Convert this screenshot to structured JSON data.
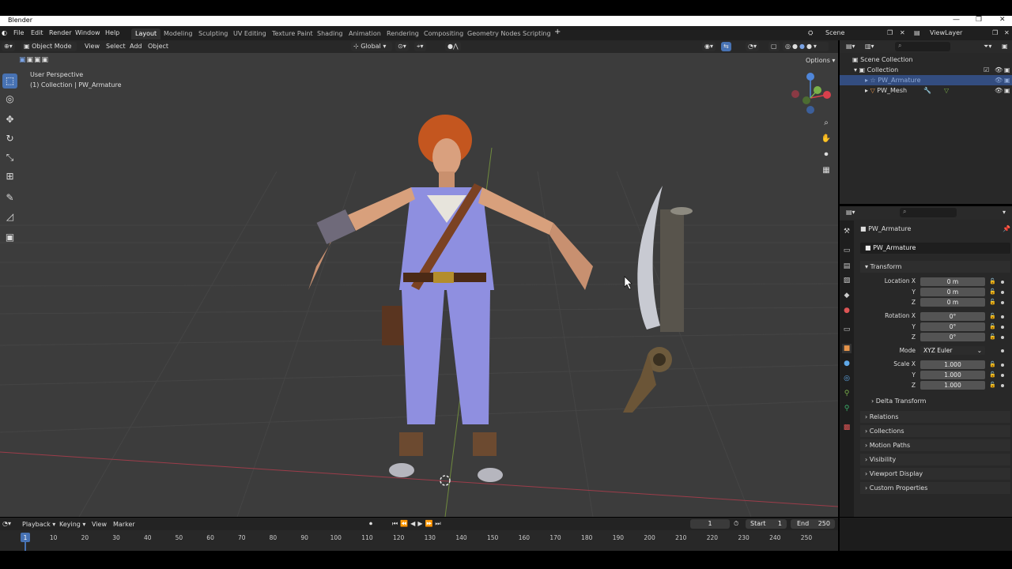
{
  "app": {
    "title": "Blender"
  },
  "menus": [
    "File",
    "Edit",
    "Render",
    "Window",
    "Help"
  ],
  "workspaces": [
    "Layout",
    "Modeling",
    "Sculpting",
    "UV Editing",
    "Texture Paint",
    "Shading",
    "Animation",
    "Rendering",
    "Compositing",
    "Geometry Nodes",
    "Scripting"
  ],
  "active_workspace": "Layout",
  "scene": {
    "name": "Scene",
    "view_layer": "ViewLayer"
  },
  "viewport_header": {
    "mode": "Object Mode",
    "menus": [
      "View",
      "Select",
      "Add",
      "Object"
    ],
    "orientation": "Global",
    "options_label": "Options"
  },
  "viewport": {
    "perspective_label": "User Perspective",
    "collection_label": "(1) Collection | PW_Armature"
  },
  "outliner": {
    "root": "Scene Collection",
    "collection": "Collection",
    "items": [
      "PW_Armature",
      "PW_Mesh"
    ]
  },
  "properties": {
    "object_name": "PW_Armature",
    "data_name": "PW_Armature",
    "transform_label": "Transform",
    "location_label": "Location X",
    "rotation_label": "Rotation X",
    "scale_label": "Scale X",
    "axis_y": "Y",
    "axis_z": "Z",
    "location": [
      "0 m",
      "0 m",
      "0 m"
    ],
    "rotation": [
      "0°",
      "0°",
      "0°"
    ],
    "mode_label": "Mode",
    "mode_value": "XYZ Euler",
    "scale": [
      "1.000",
      "1.000",
      "1.000"
    ],
    "delta_transform": "Delta Transform",
    "panels": [
      "Relations",
      "Collections",
      "Motion Paths",
      "Visibility",
      "Viewport Display",
      "Custom Properties"
    ]
  },
  "timeline": {
    "menus": [
      "Playback",
      "Keying",
      "View",
      "Marker"
    ],
    "current_frame": "1",
    "start_label": "Start",
    "start": "1",
    "end_label": "End",
    "end": "250",
    "ticks": [
      "1",
      "10",
      "20",
      "30",
      "40",
      "50",
      "60",
      "70",
      "80",
      "90",
      "100",
      "110",
      "120",
      "130",
      "140",
      "150",
      "160",
      "170",
      "180",
      "190",
      "200",
      "210",
      "220",
      "230",
      "240",
      "250"
    ]
  },
  "colors": {
    "accent": "#4772b3",
    "viewport_bg": "#3c3c3c",
    "panel_bg": "#282828",
    "selected_row": "#334d80"
  }
}
